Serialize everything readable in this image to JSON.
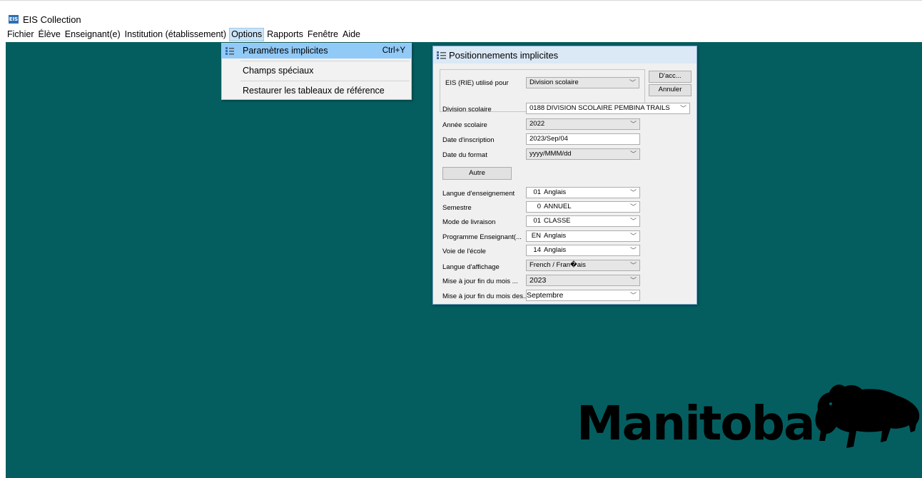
{
  "app": {
    "icon_text": "EIS",
    "title": "EIS Collection"
  },
  "menubar": [
    "Fichier",
    "Élève",
    "Enseignant(e)",
    "Institution (établissement)",
    "Options",
    "Rapports",
    "Fenêtre",
    "Aide"
  ],
  "options_menu": {
    "items": [
      {
        "label": "Paramètres implicites",
        "shortcut": "Ctrl+Y"
      },
      {
        "label": "Champs spéciaux"
      },
      {
        "label": "Restaurer les tableaux de référence"
      }
    ]
  },
  "dialog": {
    "title": "Positionnements implicites",
    "eis_label": "EIS (RIE) utilisé pour",
    "eis_value": "Division scolaire",
    "ok_button": "D'acc...",
    "cancel_button": "Annuler",
    "division_label": "Division scolaire",
    "division_code": "0188",
    "division_name": "DIVISION SCOLAIRE PEMBINA TRAILS",
    "annee_label": "Année scolaire",
    "annee_value": "2022",
    "date_insc_label": "Date d'inscription",
    "date_insc_value": "2023/Sep/04",
    "date_format_label": "Date du format",
    "date_format_value": "yyyy/MMM/dd",
    "autre_button": "Autre",
    "langue_ens_label": "Langue d'enseignement",
    "langue_ens_code": "01",
    "langue_ens_value": "Anglais",
    "semestre_label": "Semestre",
    "semestre_code": "0",
    "semestre_value": "ANNUEL",
    "mode_label": "Mode de livraison",
    "mode_code": "01",
    "mode_value": "CLASSE",
    "programme_label": "Programme Enseignant(...",
    "programme_code": "EN",
    "programme_value": "Anglais",
    "voie_label": "Voie de l'école",
    "voie_code": "14",
    "voie_value": "Anglais",
    "langue_aff_label": "Langue d'affichage",
    "langue_aff_value": "French / Fran�ais",
    "maj_annee_label": "Mise à jour fin du mois ...",
    "maj_annee_value": "2023",
    "maj_mois_label": "Mise à jour fin du mois des...",
    "maj_mois_value": "Septembre"
  },
  "logo": {
    "text": "Manitoba"
  },
  "icons": {
    "dropdown_caret": "chevron-down-icon",
    "settings": "settings-icon"
  },
  "colors": {
    "desktop": "#045e60",
    "menu_highlight": "#91c9f7",
    "dialog_title": "#dbe8f6"
  }
}
